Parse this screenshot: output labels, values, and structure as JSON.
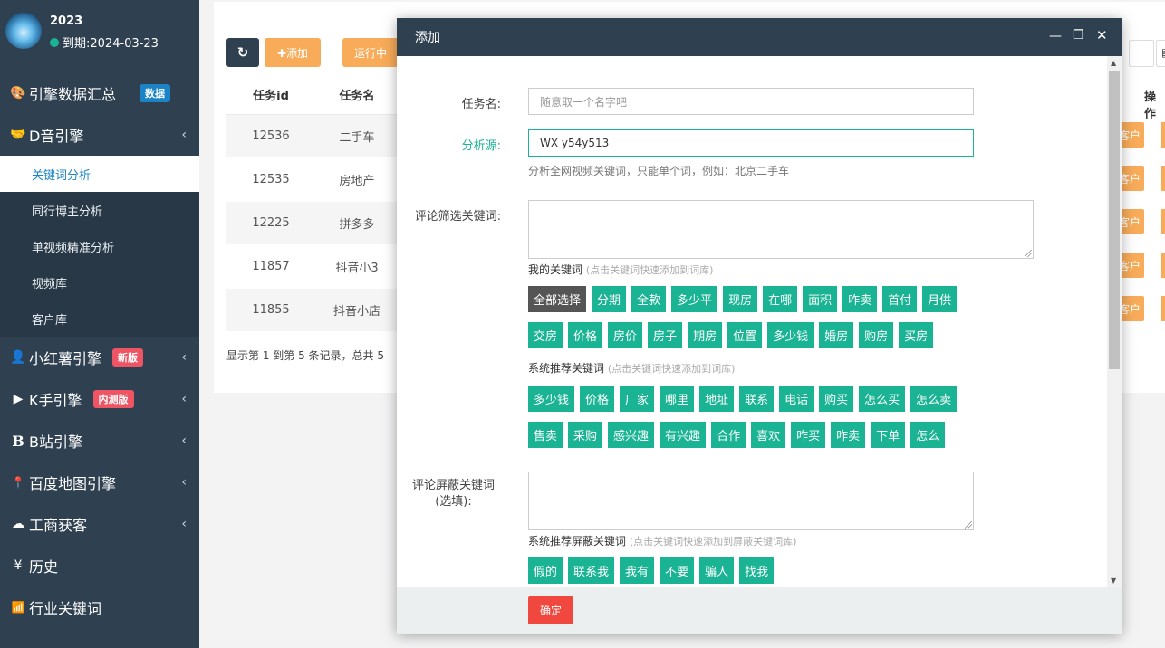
{
  "sidebar": {
    "profile": {
      "name": "2023",
      "expire": "到期:2024-03-23"
    },
    "items": [
      {
        "icon": "🎨",
        "label": "引擎数据汇总",
        "badge": "数据"
      },
      {
        "icon": "🤝",
        "label": "D音引擎"
      },
      {
        "icon": "👤",
        "label": "小红薯引擎",
        "badge": "新版"
      },
      {
        "icon": "▶",
        "label": "K手引擎",
        "badge": "内测版"
      },
      {
        "icon": "B",
        "label": "B站引擎"
      },
      {
        "icon": "📍",
        "label": "百度地图引擎"
      },
      {
        "icon": "☁",
        "label": "工商获客"
      },
      {
        "icon": "¥",
        "label": "历史"
      },
      {
        "icon": "📶",
        "label": "行业关键词"
      }
    ],
    "submenu": [
      "关键词分析",
      "同行博主分析",
      "单视频精准分析",
      "视频库",
      "客户库"
    ]
  },
  "toolbar": {
    "refresh_icon": "↻",
    "add_label": "✚添加",
    "running_label": "运行中"
  },
  "table": {
    "headers": [
      "任务id",
      "任务名"
    ],
    "rows": [
      [
        "12536",
        "二手车"
      ],
      [
        "12535",
        "房地产"
      ],
      [
        "12225",
        "拼多多"
      ],
      [
        "11857",
        "抖音小3"
      ],
      [
        "11855",
        "抖音小店"
      ]
    ],
    "ops_header": "操作",
    "customer_btn": "客户"
  },
  "summary": "显示第 1 到第 5 条记录，总共 5",
  "modal": {
    "title": "添加",
    "task_label": "任务名:",
    "task_placeholder": "随意取一个名字吧",
    "source_label": "分析源:",
    "source_value": "WX y54y513",
    "source_hint": "分析全网视频关键词，只能单个词，例如：北京二手车",
    "filter_label": "评论筛选关键词:",
    "my_kw_title": "我的关键词",
    "my_kw_hint": "(点击关键词快速添加到词库)",
    "my_kw_row1": [
      "全部选择",
      "分期",
      "全款",
      "多少平",
      "现房",
      "在哪",
      "面积",
      "咋卖",
      "首付",
      "月供"
    ],
    "my_kw_row2": [
      "交房",
      "价格",
      "房价",
      "房子",
      "期房",
      "位置",
      "多少钱",
      "婚房",
      "购房",
      "买房"
    ],
    "sys_kw_title": "系统推荐关键词",
    "sys_kw_hint": "(点击关键词快速添加到词库)",
    "sys_kw_row1": [
      "多少钱",
      "价格",
      "厂家",
      "哪里",
      "地址",
      "联系",
      "电话",
      "购买",
      "怎么买",
      "怎么卖"
    ],
    "sys_kw_row2": [
      "售卖",
      "采购",
      "感兴趣",
      "有兴趣",
      "合作",
      "喜欢",
      "咋买",
      "咋卖",
      "下单",
      "怎么"
    ],
    "block_label_1": "评论屏蔽关键词",
    "block_label_2": "(选填):",
    "block_title": "系统推荐屏蔽关键词",
    "block_hint": "(点击关键词快速添加到屏蔽关键词库)",
    "block_tags": [
      "假的",
      "联系我",
      "我有",
      "不要",
      "骗人",
      "找我"
    ],
    "ok_label": "确定"
  },
  "colors": {
    "sidebar": "#2f4050",
    "tag": "#1ab394",
    "orange": "#f8ac59",
    "ok": "#f0483e"
  }
}
